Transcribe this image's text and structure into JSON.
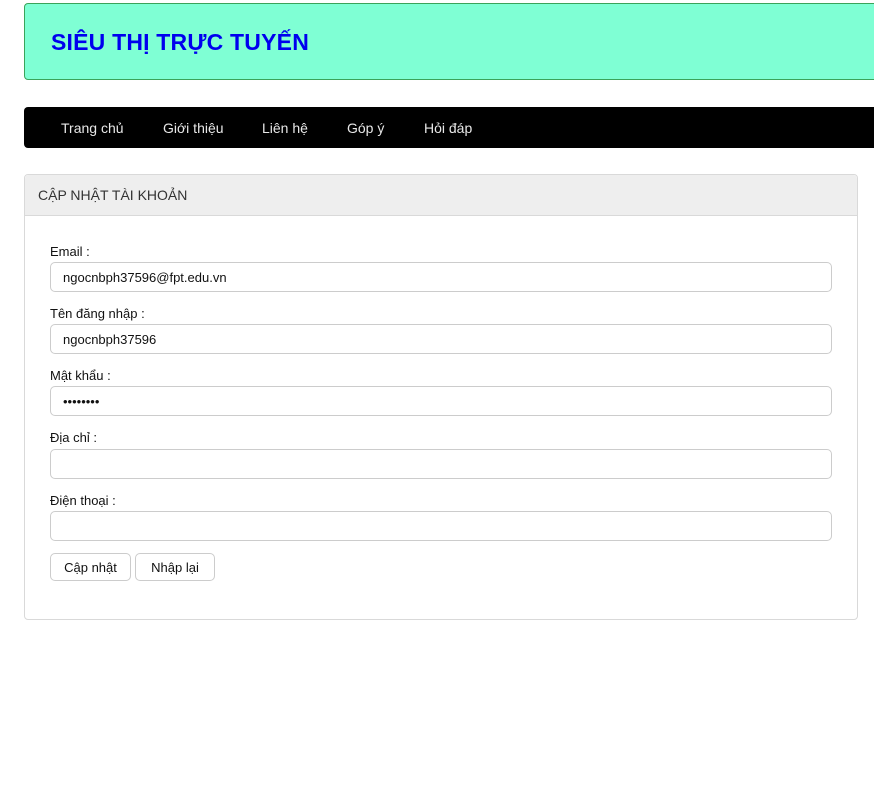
{
  "header": {
    "title": "SIÊU THỊ TRỰC TUYẾN",
    "background_color": "#7fffd4",
    "title_color": "#0000ee"
  },
  "nav": {
    "items": [
      {
        "label": "Trang chủ"
      },
      {
        "label": "Giới thiệu"
      },
      {
        "label": "Liên hệ"
      },
      {
        "label": "Góp ý"
      },
      {
        "label": "Hỏi đáp"
      }
    ]
  },
  "panel": {
    "heading": "CẬP NHẬT TÀI KHOẢN",
    "fields": [
      {
        "label": "Email :",
        "value": "ngocnbph37596@fpt.edu.vn",
        "type": "text"
      },
      {
        "label": "Tên đăng nhập :",
        "value": "ngocnbph37596",
        "type": "text"
      },
      {
        "label": "Mật khẩu :",
        "value": "••••••••",
        "type": "password"
      },
      {
        "label": "Địa chỉ :",
        "value": "",
        "type": "text"
      },
      {
        "label": "Điện thoại :",
        "value": "",
        "type": "text"
      }
    ],
    "buttons": {
      "update": "Cập nhật",
      "reset": "Nhập lại"
    }
  }
}
